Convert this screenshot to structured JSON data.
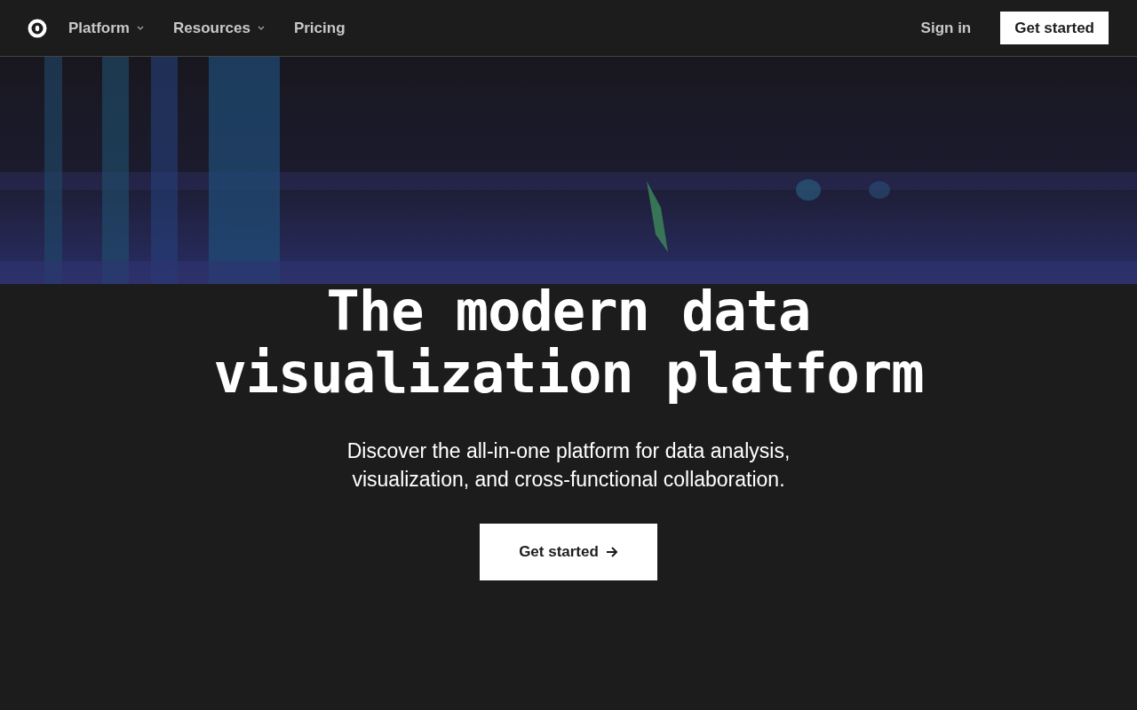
{
  "nav": {
    "items": [
      {
        "label": "Platform",
        "dropdown": true
      },
      {
        "label": "Resources",
        "dropdown": true
      },
      {
        "label": "Pricing",
        "dropdown": false
      }
    ],
    "sign_in": "Sign in",
    "cta": "Get started"
  },
  "hero": {
    "background": {
      "kind": "picture"
    },
    "title_lines": [
      "The modern data",
      "visualization platform"
    ],
    "subtitle_lines": [
      "Discover the all-in-one platform for data analysis,",
      "visualization, and cross-functional collaboration."
    ],
    "button": "Get started"
  }
}
